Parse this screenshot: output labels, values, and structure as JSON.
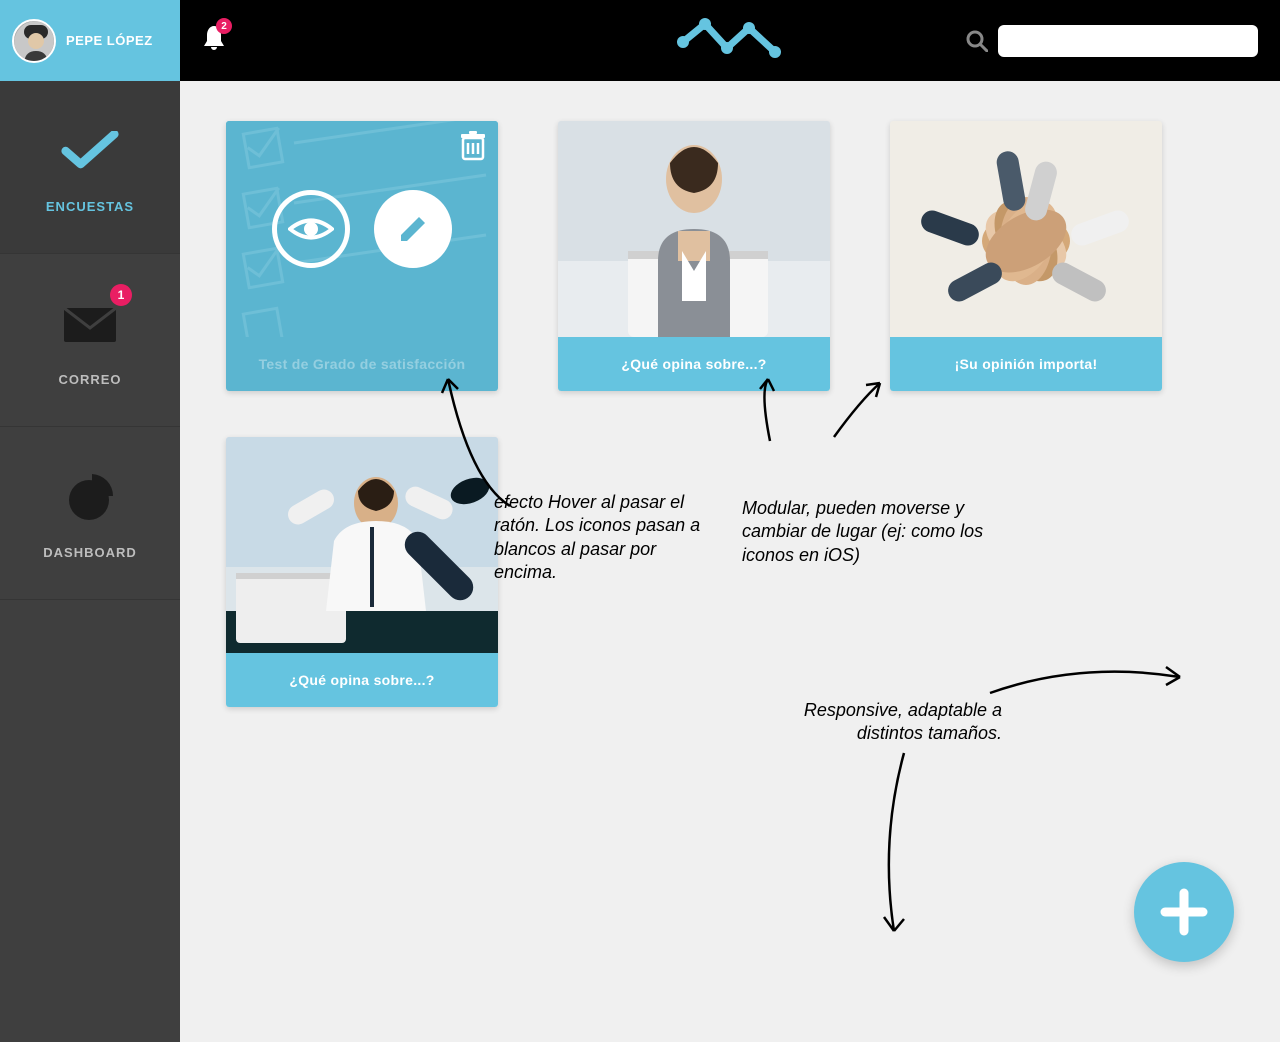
{
  "user": {
    "name": "PEPE LÓPEZ"
  },
  "nav": {
    "surveys": "ENCUESTAS",
    "mail": "CORREO",
    "mail_badge": "1",
    "dashboard": "DASHBOARD"
  },
  "topbar": {
    "notif_badge": "2",
    "search_placeholder": ""
  },
  "cards": [
    {
      "title": "Test de Grado de satisfacción"
    },
    {
      "title": "¿Qué opina sobre...?"
    },
    {
      "title": "¡Su opinión importa!"
    },
    {
      "title": "¿Qué opina sobre...?"
    }
  ],
  "annotations": {
    "hover": "efecto Hover al pasar el ratón. Los iconos pasan a blancos al pasar por encima.",
    "modular": "Modular, pueden moverse y cambiar de lugar (ej: como los iconos en iOS)",
    "responsive": "Responsive, adaptable a distintos tamaños."
  },
  "colors": {
    "accent": "#65c4e0",
    "badge": "#e91e63",
    "sidebar": "#3f3f3f"
  }
}
